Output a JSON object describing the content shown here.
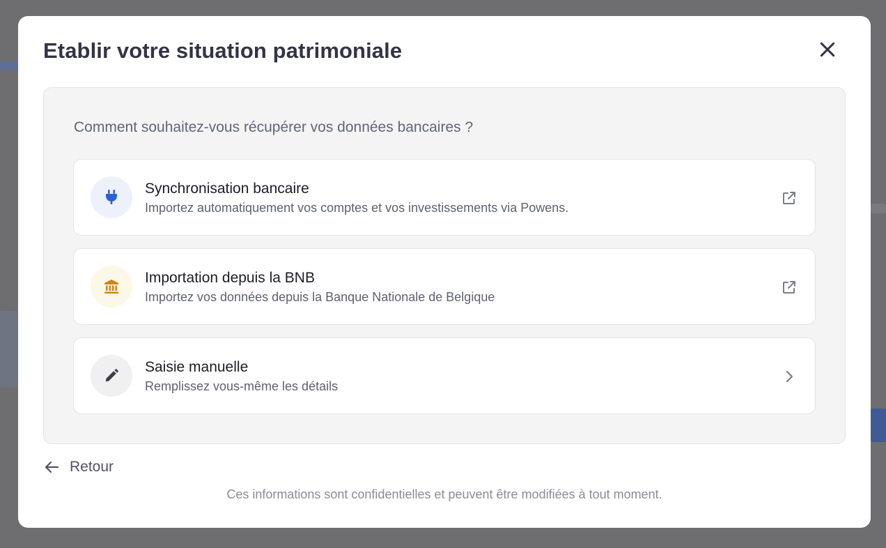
{
  "modal": {
    "title": "Etablir votre situation patrimoniale",
    "close_icon": "close-icon"
  },
  "panel": {
    "question": "Comment souhaitez-vous récupérer vos données bancaires ?",
    "options": [
      {
        "title": "Synchronisation bancaire",
        "description": "Importez automatiquement vos comptes et vos investissements via Powens.",
        "icon": "plug-icon",
        "trailing_icon": "external-link-icon",
        "icon_color": "#2f5fd8",
        "icon_bg": "#ecf1fb"
      },
      {
        "title": "Importation depuis la BNB",
        "description": "Importez vos données depuis la Banque Nationale de Belgique",
        "icon": "bank-icon",
        "trailing_icon": "external-link-icon",
        "icon_color": "#d4830f",
        "icon_bg": "#fdf7e8"
      },
      {
        "title": "Saisie manuelle",
        "description": "Remplissez vous-même les détails",
        "icon": "pencil-icon",
        "trailing_icon": "chevron-right-icon",
        "icon_color": "#3c3e4a",
        "icon_bg": "#f0f0f2"
      }
    ]
  },
  "back": {
    "label": "Retour",
    "icon": "arrow-left-icon"
  },
  "footnote": "Ces informations sont confidentielles et peuvent être modifiées à tout moment."
}
